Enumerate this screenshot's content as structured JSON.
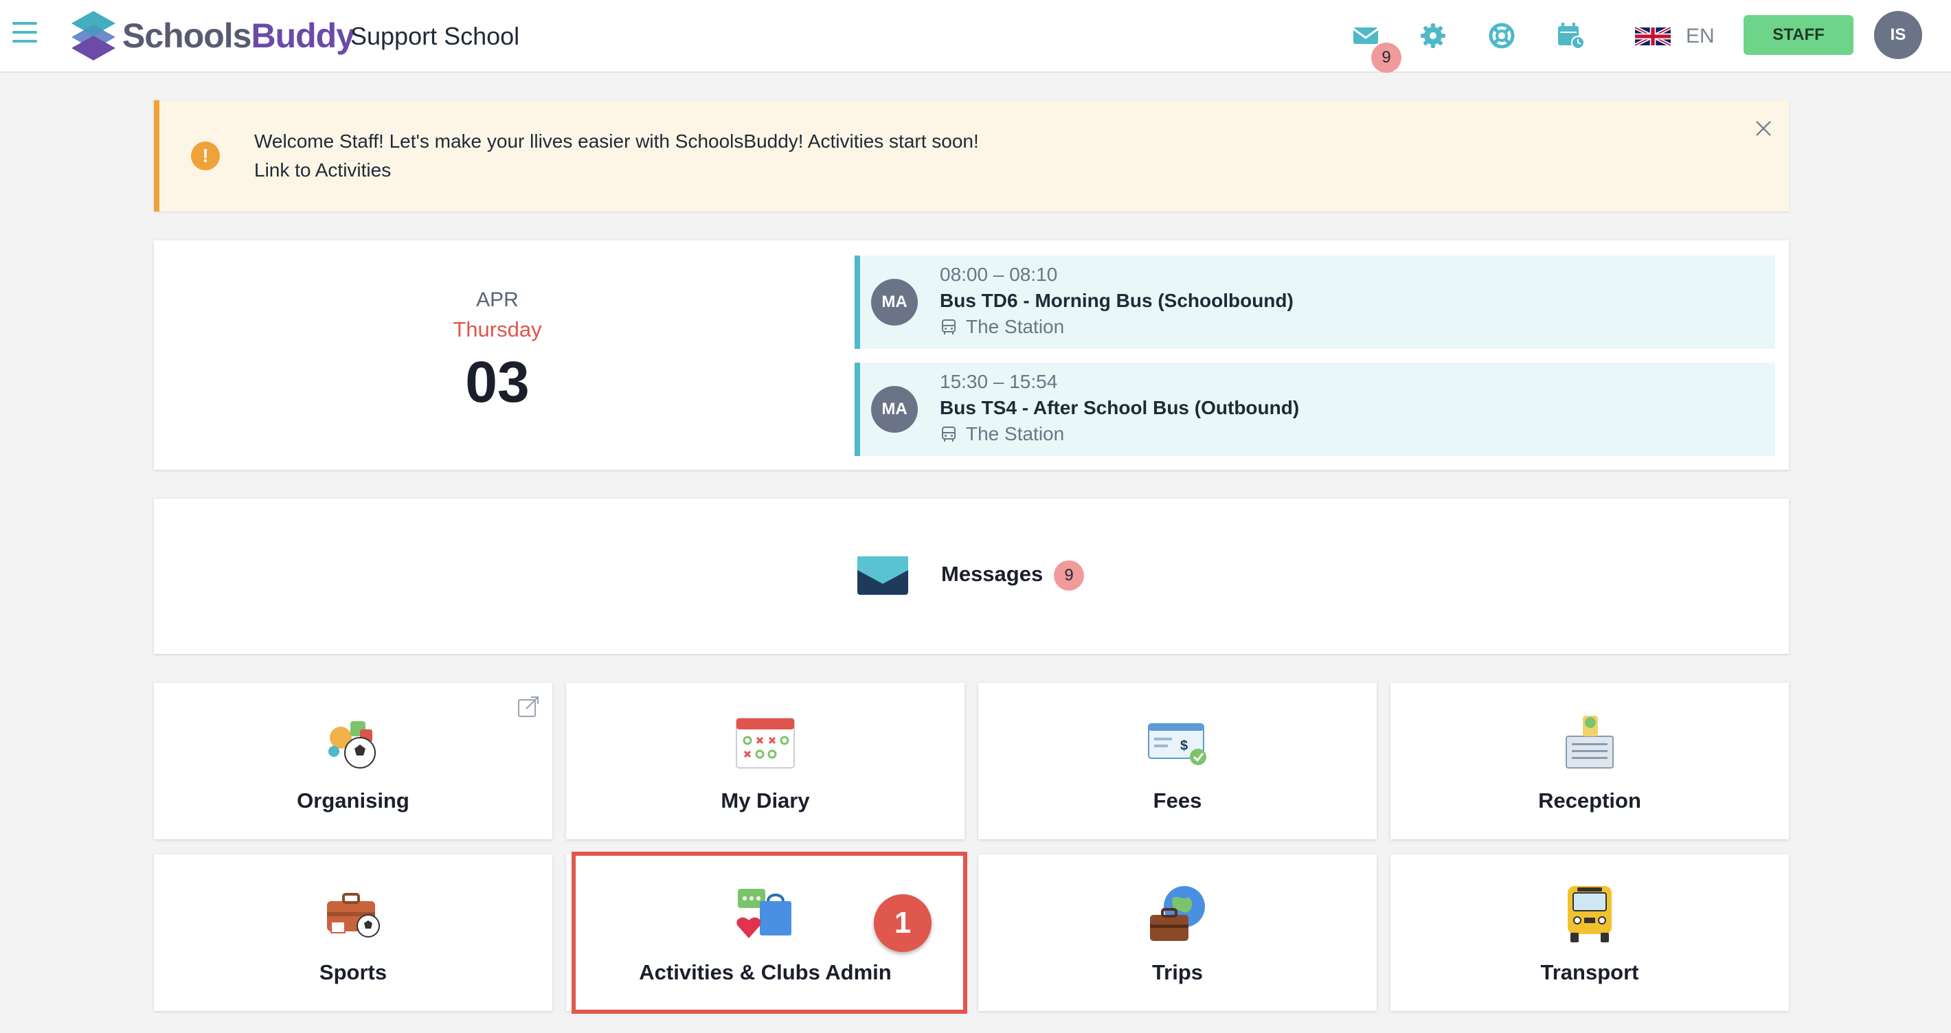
{
  "header": {
    "logo_text_a": "Schools",
    "logo_text_b": "Buddy",
    "school_name": "Support School",
    "mail_badge": "9",
    "language": "EN",
    "staff_label": "STAFF",
    "user_initials": "IS"
  },
  "alert": {
    "line1": "Welcome Staff!  Let's make your llives easier with SchoolsBuddy!  Activities start soon!",
    "line2_prefix": "Link to ",
    "line2_link": "Activities",
    "icon": "!"
  },
  "calendar": {
    "month": "APR",
    "weekday": "Thursday",
    "day": "03",
    "events": [
      {
        "initials": "MA",
        "time": "08:00 – 08:10",
        "title": "Bus TD6 - Morning Bus (Schoolbound)",
        "location": "The Station"
      },
      {
        "initials": "MA",
        "time": "15:30 – 15:54",
        "title": "Bus TS4 - After School Bus (Outbound)",
        "location": "The Station"
      }
    ]
  },
  "messages": {
    "label": "Messages",
    "count": "9"
  },
  "tiles": [
    {
      "label": "Organising",
      "icon": "organising-icon"
    },
    {
      "label": "My Diary",
      "icon": "diary-icon"
    },
    {
      "label": "Fees",
      "icon": "fees-icon"
    },
    {
      "label": "Reception",
      "icon": "reception-icon"
    },
    {
      "label": "Sports",
      "icon": "sports-icon"
    },
    {
      "label": "Activities & Clubs Admin",
      "icon": "activities-icon"
    },
    {
      "label": "Trips",
      "icon": "trips-icon"
    },
    {
      "label": "Transport",
      "icon": "transport-icon"
    }
  ],
  "annotation": {
    "step": "1"
  },
  "colors": {
    "accent": "#4fb8c9",
    "staff": "#6ed48a",
    "alert": "#f0a23a",
    "highlight": "#e0574d",
    "weekday": "#e0544e"
  }
}
